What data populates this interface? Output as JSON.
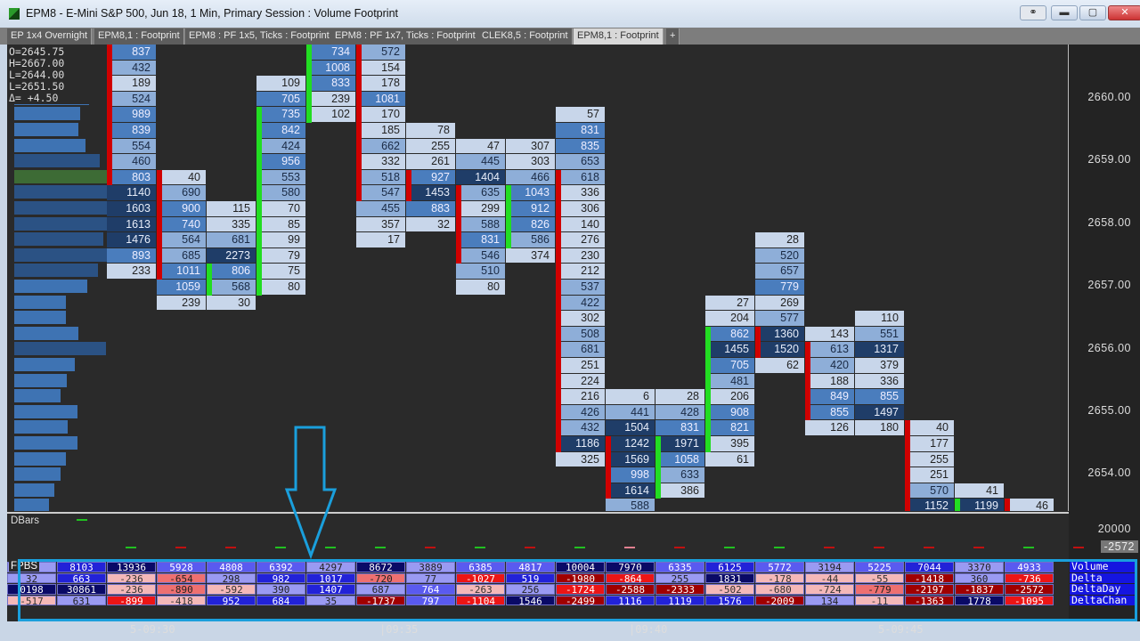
{
  "window": {
    "title": "EPM8 - E-Mini S&P 500, Jun 18, 1 Min, Primary Session : Volume Footprint",
    "buttons": [
      "link-icon",
      "minimize-icon",
      "maximize-icon",
      "close-icon"
    ]
  },
  "tabs": [
    {
      "label": "EP 1x4 Overnight"
    },
    {
      "label": "EPM8,1 : Footprint"
    },
    {
      "label": "EPM8 : PF 1x5, Ticks : Footprint"
    },
    {
      "label": "EPM8 : PF 1x7, Ticks : Footprint"
    },
    {
      "label": "CLEK8,5 : Footprint"
    },
    {
      "label": "EPM8,1 : Footprint",
      "active": true
    },
    {
      "label": "+"
    }
  ],
  "ohlc": {
    "open": "O=2645.75",
    "high": "H=2667.00",
    "low": "L=2644.00",
    "last": "L=2651.50",
    "delta": "Δ=  +4.50"
  },
  "price_axis": [
    "2660.00",
    "2659.00",
    "2658.00",
    "2657.00",
    "2656.00",
    "2655.00",
    "2654.00"
  ],
  "lower_axis": {
    "top": "20000",
    "current": "-2572"
  },
  "colors": {
    "red": "#d00000",
    "green": "#22dd22",
    "highlight": "#1a9fdc"
  },
  "volume_profile": [
    0.75,
    0.66,
    0.64,
    0.71,
    0.86,
    1,
    1,
    0.97,
    0.95,
    0.89,
    1,
    0.84,
    0.73,
    0.52,
    0.52,
    0.64,
    0.92,
    0.61,
    0.53,
    0.46,
    0.63,
    0.54,
    0.63,
    0.52,
    0.46,
    0.4,
    0.35
  ],
  "footprint": [
    {
      "start": 0,
      "values": [
        837,
        432,
        189,
        524,
        989,
        839,
        554,
        460,
        803,
        1140,
        1603,
        1613,
        1476,
        893,
        233
      ],
      "marker": {
        "color": "red",
        "from": 0,
        "to": 8
      }
    },
    {
      "start": 8,
      "values": [
        40,
        690,
        900,
        740,
        564,
        685,
        1011,
        1059,
        239
      ],
      "marker": {
        "color": "red",
        "from": 0,
        "to": 6
      }
    },
    {
      "start": 10,
      "values": [
        115,
        335,
        681,
        2273,
        806,
        568,
        30
      ],
      "marker": {
        "color": "green",
        "from": 4,
        "to": 5
      }
    },
    {
      "start": 2,
      "values": [
        109,
        705,
        735,
        842,
        424,
        956,
        553,
        580,
        70,
        85,
        99,
        79,
        75,
        80
      ],
      "marker": {
        "color": "green",
        "from": 2,
        "to": 13
      }
    },
    {
      "start": 0,
      "values": [
        734,
        1008,
        833,
        239,
        102
      ],
      "marker": {
        "color": "green",
        "from": 0,
        "to": 4
      }
    },
    {
      "start": 0,
      "values": [
        572,
        154,
        178,
        1081,
        170,
        185,
        662,
        332,
        518,
        547,
        455,
        357,
        17
      ],
      "marker": {
        "color": "red",
        "from": 0,
        "to": 9
      }
    },
    {
      "start": 5,
      "values": [
        78,
        255,
        261,
        927,
        1453,
        883,
        32
      ],
      "marker": {
        "color": "red",
        "from": 3,
        "to": 4
      }
    },
    {
      "start": 6,
      "values": [
        47,
        445,
        1404,
        635,
        299,
        588,
        831,
        546,
        510,
        80
      ],
      "marker": {
        "color": "red",
        "from": 3,
        "to": 7
      }
    },
    {
      "start": 6,
      "values": [
        307,
        303,
        466,
        1043,
        912,
        826,
        586,
        374
      ],
      "marker": {
        "color": "green",
        "from": 3,
        "to": 6
      }
    },
    {
      "start": 4,
      "values": [
        57,
        831,
        835,
        653,
        618,
        336,
        306,
        140,
        276,
        230,
        212,
        537,
        422,
        302,
        508,
        681,
        251,
        224,
        216,
        426,
        432,
        1186,
        325
      ],
      "marker": {
        "color": "red",
        "from": 4,
        "to": 21
      }
    },
    {
      "start": 22,
      "values": [
        6,
        441,
        1504,
        1242,
        1569,
        998,
        1614,
        588
      ],
      "marker": {
        "color": "red",
        "from": 3,
        "to": 6
      }
    },
    {
      "start": 22,
      "values": [
        28,
        428,
        831,
        1971,
        1058,
        633,
        386
      ],
      "marker": {
        "color": "green",
        "from": 3,
        "to": 6
      }
    },
    {
      "start": 16,
      "values": [
        27,
        204,
        862,
        1455,
        705,
        481,
        206,
        908,
        821,
        395,
        61
      ],
      "marker": {
        "color": "green",
        "from": 2,
        "to": 9
      }
    },
    {
      "start": 12,
      "values": [
        28,
        520,
        657,
        779,
        269,
        577,
        1360,
        1520,
        62
      ],
      "marker": {
        "color": "red",
        "from": 6,
        "to": 7
      }
    },
    {
      "start": 18,
      "values": [
        143,
        613,
        420,
        188,
        849,
        855,
        126
      ],
      "marker": {
        "color": "red",
        "from": 1,
        "to": 5
      }
    },
    {
      "start": 17,
      "values": [
        110,
        551,
        1317,
        379,
        336,
        855,
        1497,
        180
      ],
      "marker": null
    },
    {
      "start": 24,
      "values": [
        40,
        177,
        255,
        251,
        570,
        1152
      ],
      "marker": {
        "color": "red",
        "from": 0,
        "to": 5
      }
    },
    {
      "start": 28,
      "values": [
        41,
        1199
      ],
      "marker": {
        "color": "green",
        "from": 1,
        "to": 1
      }
    },
    {
      "start": 29,
      "values": [
        46
      ],
      "marker": {
        "color": "red",
        "from": 0,
        "to": 0
      }
    }
  ],
  "dbars": {
    "label": "DBars",
    "ticks": [
      "green",
      "red",
      "red",
      "green",
      "green",
      "green",
      "red",
      "green",
      "red",
      "green",
      "pink",
      "red",
      "green",
      "green",
      "red",
      "red",
      "red",
      "red",
      "green",
      "red"
    ]
  },
  "table": {
    "label": "FPBS",
    "row_labels": [
      "Volume",
      "Delta",
      "DeltaDay",
      "DeltaChan"
    ],
    "rows": [
      {
        "values": [
          "",
          "8103",
          "13936",
          "5928",
          "4808",
          "6392",
          "4297",
          "8672",
          "3889",
          "6385",
          "4817",
          "10004",
          "7970",
          "6335",
          "6125",
          "5772",
          "3194",
          "5225",
          "7044",
          "3370",
          "4933"
        ],
        "colors": "LBDMMMLDLMMDDMBMLMBLM"
      },
      {
        "values": [
          "32",
          "663",
          "-236",
          "-654",
          "298",
          "982",
          "1017",
          "-720",
          "77",
          "-1027",
          "519",
          "-1980",
          "-864",
          "255",
          "1831",
          "-178",
          "-44",
          "-55",
          "-1418",
          "360",
          "-736"
        ],
        "colors": "LBPSLBBSLRBKRLDPPPKLR"
      },
      {
        "values": [
          "0198",
          "30861",
          "-236",
          "-890",
          "-592",
          "390",
          "1407",
          "687",
          "764",
          "-263",
          "256",
          "-1724",
          "-2588",
          "-2333",
          "-502",
          "-680",
          "-724",
          "-779",
          "-2197",
          "-1837",
          "-2572"
        ],
        "colors": "DDPSPLBLMPLRKKPPPSKKK"
      },
      {
        "values": [
          "-517",
          "631",
          "-899",
          "-418",
          "952",
          "684",
          "35",
          "-1737",
          "797",
          "-1104",
          "1546",
          "-2499",
          "1116",
          "1119",
          "1576",
          "-2009",
          "134",
          "-11",
          "-1363",
          "1778",
          "-1095"
        ],
        "colors": "PLRPBBLKMRDKBBBKLPKDR"
      }
    ]
  },
  "time_axis": [
    "5-09:30",
    "|09:35",
    "|09:40",
    "5-09:45"
  ]
}
